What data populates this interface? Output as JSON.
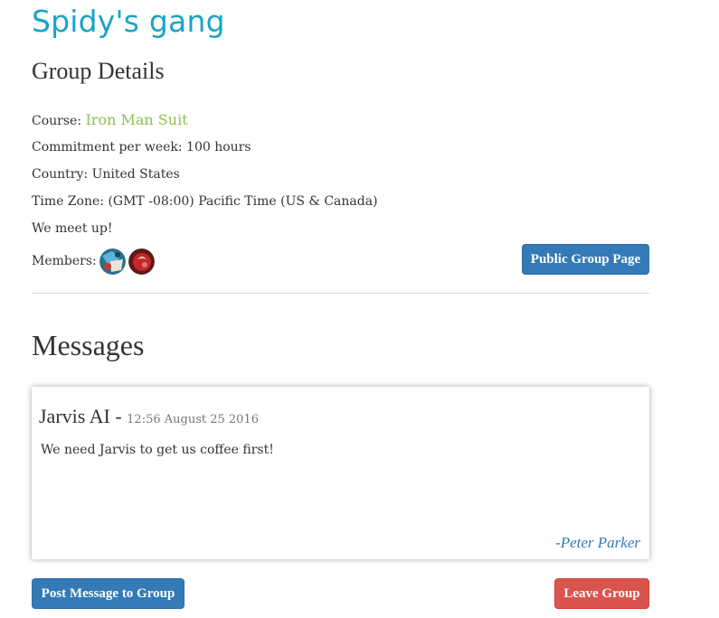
{
  "brand": {
    "title": "Spidy's gang"
  },
  "group_details": {
    "heading": "Group Details",
    "course_label": "Course:",
    "course_value": "Iron Man Suit",
    "commitment": "Commitment per week: 100 hours",
    "country": "Country: United States",
    "time_zone": "Time Zone: (GMT -08:00) Pacific Time (US & Canada)",
    "meet": "We meet up!",
    "members_label": "Members:",
    "public_page_button": "Public Group Page"
  },
  "messages": {
    "heading": "Messages",
    "items": [
      {
        "title": "Jarvis AI",
        "separator": " - ",
        "timestamp": "12:56 August 25 2016",
        "body": "We need Jarvis to get us coffee first!",
        "author": "-Peter Parker"
      }
    ]
  },
  "actions": {
    "post_button": "Post Message to Group",
    "leave_button": "Leave Group"
  },
  "colors": {
    "brand": "#1aa3c9",
    "course_link": "#8bc34a",
    "primary": "#337ab7",
    "danger": "#d9534f"
  }
}
